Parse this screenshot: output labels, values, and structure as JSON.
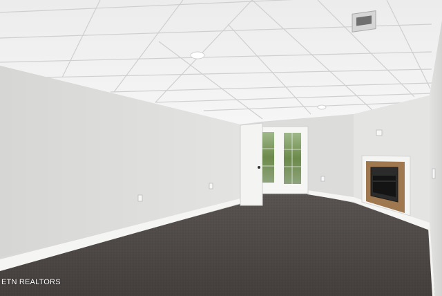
{
  "photo": {
    "subject": "",
    "watermark": "ETN REALTORS"
  },
  "colors": {
    "ceiling": "#f1f1f1",
    "left_wall": "#e0e0de",
    "back_wall": "#dadbd9",
    "right_wall": "#e6e6e4",
    "carpet": "#4d4846",
    "baseboard": "#f5f5f3",
    "fireplace_surround": "#a0784f",
    "fireplace_mantel": "#f4f4f2",
    "door_frame": "#f6f6f4",
    "glass_foliage": "#6c8a4a"
  }
}
